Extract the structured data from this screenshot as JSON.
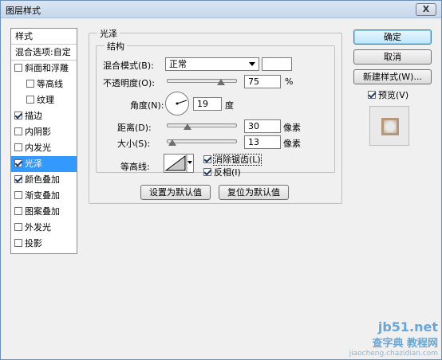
{
  "window": {
    "title": "图层样式",
    "close": "X"
  },
  "stylelist": {
    "header": "样式",
    "blend_options": "混合选项:自定",
    "items": [
      {
        "label": "斜面和浮雕",
        "checked": false,
        "indent": false
      },
      {
        "label": "等高线",
        "checked": false,
        "indent": true
      },
      {
        "label": "纹理",
        "checked": false,
        "indent": true
      },
      {
        "label": "描边",
        "checked": true,
        "indent": false
      },
      {
        "label": "内阴影",
        "checked": false,
        "indent": false
      },
      {
        "label": "内发光",
        "checked": false,
        "indent": false
      },
      {
        "label": "光泽",
        "checked": true,
        "indent": false,
        "selected": true
      },
      {
        "label": "颜色叠加",
        "checked": true,
        "indent": false
      },
      {
        "label": "渐变叠加",
        "checked": false,
        "indent": false
      },
      {
        "label": "图案叠加",
        "checked": false,
        "indent": false
      },
      {
        "label": "外发光",
        "checked": false,
        "indent": false
      },
      {
        "label": "投影",
        "checked": false,
        "indent": false
      }
    ]
  },
  "satin": {
    "group_title": "光泽",
    "structure_title": "结构",
    "blend_mode_label": "混合模式(B):",
    "blend_mode_value": "正常",
    "opacity_label": "不透明度(O):",
    "opacity_value": "75",
    "opacity_unit": "%",
    "angle_label": "角度(N):",
    "angle_value": "19",
    "angle_unit": "度",
    "distance_label": "距离(D):",
    "distance_value": "30",
    "distance_unit": "像素",
    "size_label": "大小(S):",
    "size_value": "13",
    "size_unit": "像素",
    "contour_label": "等高线:",
    "antialias_label": "消除锯齿(L)",
    "antialias_checked": true,
    "invert_label": "反相(I)",
    "invert_checked": true,
    "make_default": "设置为默认值",
    "reset_default": "复位为默认值"
  },
  "buttons": {
    "ok": "确定",
    "cancel": "取消",
    "new_style": "新建样式(W)...",
    "preview_label": "预览(V)",
    "preview_checked": true
  },
  "watermark": {
    "line1": "jb51.net",
    "line2": "查字典 教程网",
    "line3": "jiaocheng.chazidian.com"
  }
}
